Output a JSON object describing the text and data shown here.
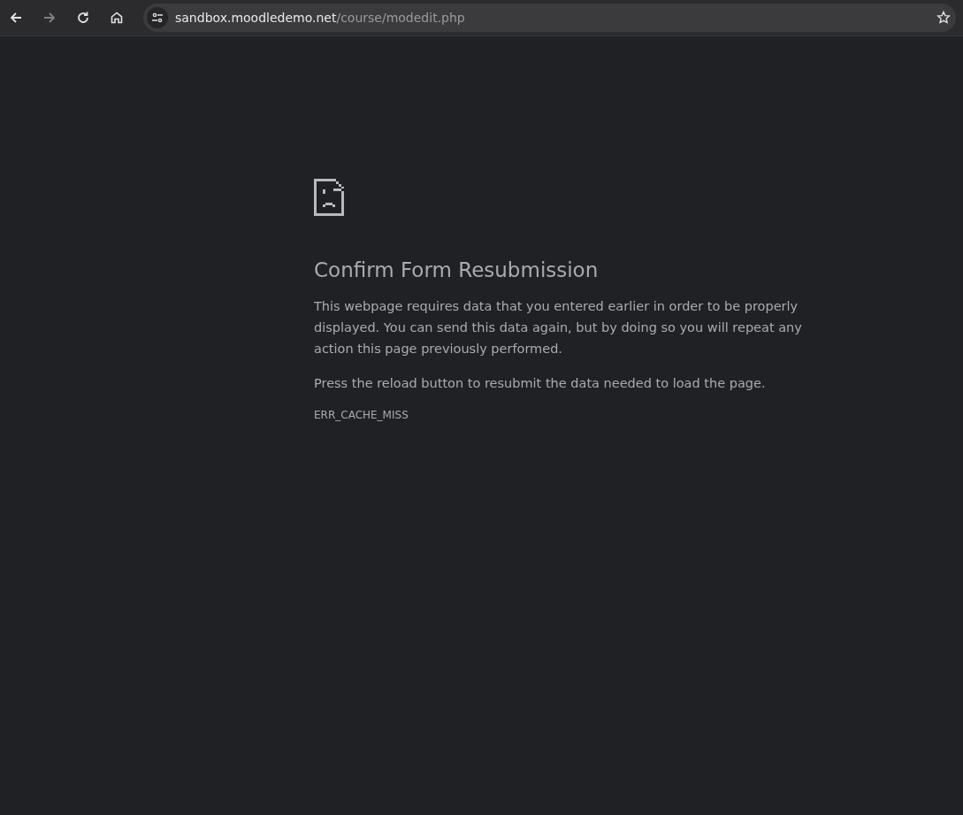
{
  "toolbar": {
    "back": {
      "disabled": false
    },
    "forward": {
      "disabled": true
    },
    "address": {
      "host": "sandbox.moodledemo.net",
      "path": "/course/modedit.php"
    },
    "bookmarked": false
  },
  "error": {
    "title": "Confirm Form Resubmission",
    "paragraphs": [
      "This webpage requires data that you entered earlier in order to be properly displayed. You can send this data again, but by doing so you will repeat any action this page previously performed.",
      "Press the reload button to resubmit the data needed to load the page."
    ],
    "code": "ERR_CACHE_MISS"
  }
}
